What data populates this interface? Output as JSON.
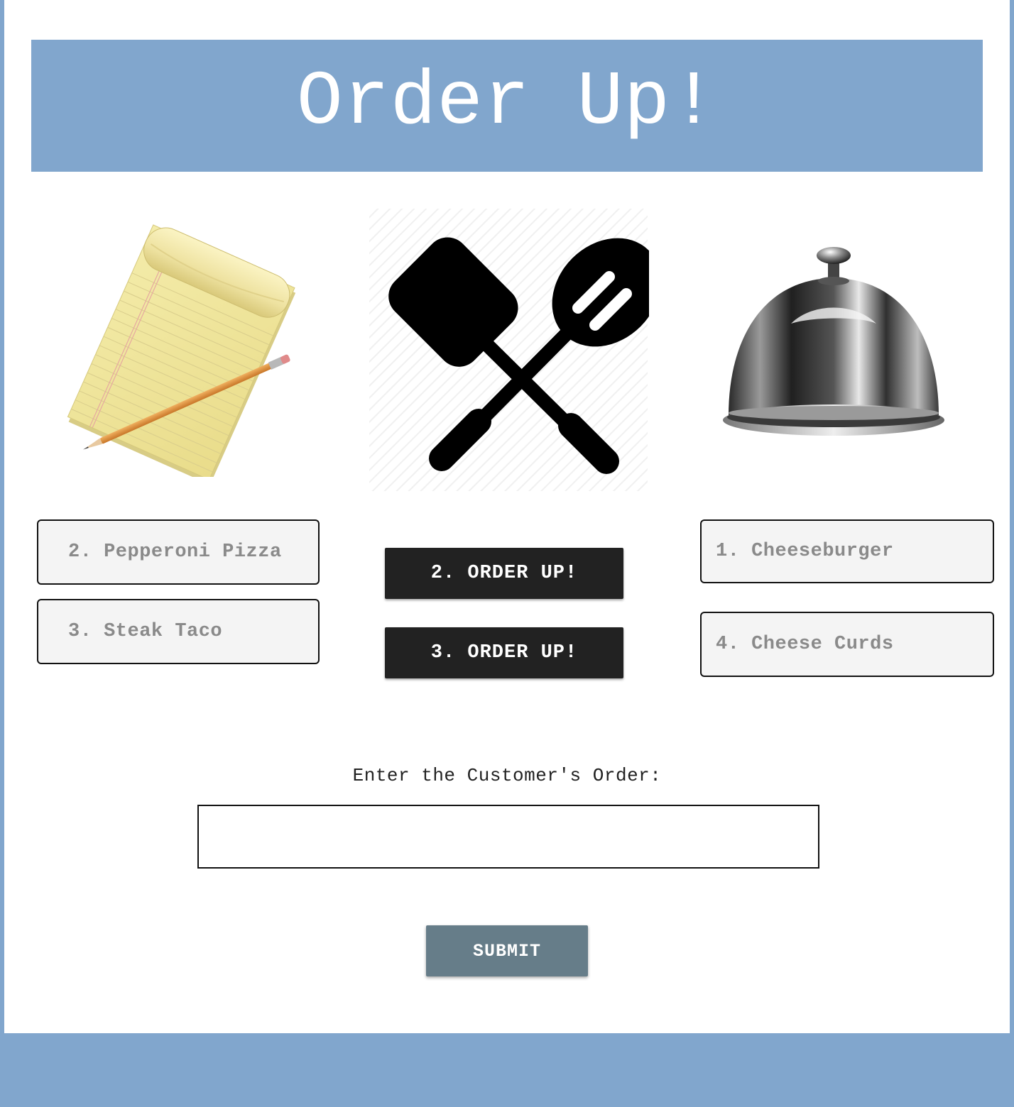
{
  "header": {
    "title": "Order Up!"
  },
  "illustrations": {
    "left": "notepad-with-pencil",
    "center": "crossed-spatula-and-slotted-spoon",
    "right": "silver-cloche"
  },
  "queue_orders": [
    {
      "label": "2. Pepperoni Pizza"
    },
    {
      "label": "3. Steak Taco"
    }
  ],
  "order_up_buttons": [
    {
      "label": "2. ORDER UP!"
    },
    {
      "label": "3. ORDER UP!"
    }
  ],
  "served_orders": [
    {
      "label": "1. Cheeseburger"
    },
    {
      "label": "4. Cheese Curds"
    }
  ],
  "form": {
    "prompt": "Enter the Customer's Order:",
    "input_value": "",
    "submit_label": "SUBMIT"
  },
  "colors": {
    "brand_blue": "#81a6cd",
    "dark_button": "#222222",
    "submit_button": "#667d89",
    "order_box_bg": "#f4f4f4",
    "order_text": "#8a8a8a"
  }
}
